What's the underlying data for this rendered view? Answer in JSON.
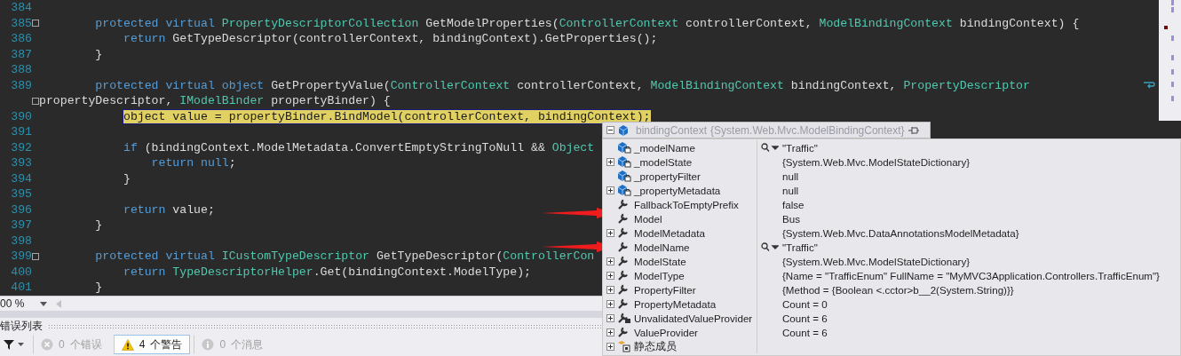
{
  "editor": {
    "lines": [
      {
        "kind": "line",
        "number": "384",
        "fold": false,
        "highlighted": false
      },
      {
        "kind": "line",
        "number": "385",
        "fold": true,
        "highlighted": false,
        "segments": [
          {
            "text": "        protected virtual",
            "kind": "keyword"
          },
          {
            "text": " PropertyDescriptorCollection",
            "kind": "type"
          },
          {
            "text": " GetModelProperties(",
            "kind": "plain"
          },
          {
            "text": "ControllerContext",
            "kind": "type"
          },
          {
            "text": " controllerContext, ",
            "kind": "plain"
          },
          {
            "text": "ModelBindingContext",
            "kind": "type"
          },
          {
            "text": " bindingContext) {",
            "kind": "plain"
          }
        ]
      },
      {
        "kind": "line",
        "number": "386",
        "fold": false,
        "highlighted": false,
        "segments": [
          {
            "text": "            return",
            "kind": "keyword"
          },
          {
            "text": " GetTypeDescriptor(controllerContext, bindingContext).GetProperties();",
            "kind": "plain"
          }
        ]
      },
      {
        "kind": "line",
        "number": "387",
        "fold": false,
        "highlighted": false,
        "segments": [
          {
            "text": "        }",
            "kind": "plain"
          }
        ]
      },
      {
        "kind": "line",
        "number": "388",
        "fold": false,
        "highlighted": false
      },
      {
        "kind": "line",
        "number": "389",
        "fold": false,
        "highlighted": false,
        "wrapped": true,
        "segments": [
          {
            "text": "        protected virtual object",
            "kind": "keyword"
          },
          {
            "text": " GetPropertyValue(",
            "kind": "plain"
          },
          {
            "text": "ControllerContext",
            "kind": "type"
          },
          {
            "text": " controllerContext, ",
            "kind": "plain"
          },
          {
            "text": "ModelBindingContext",
            "kind": "type"
          },
          {
            "text": " bindingContext, ",
            "kind": "plain"
          },
          {
            "text": "PropertyDescriptor",
            "kind": "type"
          }
        ]
      },
      {
        "kind": "wrap",
        "fold": true,
        "highlighted": false,
        "segments": [
          {
            "text": "propertyDescriptor, ",
            "kind": "plain"
          },
          {
            "text": "IModelBinder",
            "kind": "type"
          },
          {
            "text": " propertyBinder) {",
            "kind": "plain"
          }
        ]
      },
      {
        "kind": "line",
        "number": "390",
        "fold": false,
        "highlighted": true,
        "segments": [
          {
            "text": "            object",
            "kind": "keyword"
          },
          {
            "text": " value = propertyBinder.BindModel(controllerContext, bindingContext);",
            "kind": "plain"
          }
        ]
      },
      {
        "kind": "line",
        "number": "391",
        "fold": false,
        "highlighted": false
      },
      {
        "kind": "line",
        "number": "392",
        "fold": false,
        "highlighted": false,
        "segments": [
          {
            "text": "            if",
            "kind": "keyword"
          },
          {
            "text": " (bindingContext.ModelMetadata.ConvertEmptyStringToNull && ",
            "kind": "plain"
          },
          {
            "text": "Object",
            "kind": "type"
          }
        ]
      },
      {
        "kind": "line",
        "number": "393",
        "fold": false,
        "highlighted": false,
        "segments": [
          {
            "text": "                return null",
            "kind": "keyword"
          },
          {
            "text": ";",
            "kind": "plain"
          }
        ]
      },
      {
        "kind": "line",
        "number": "394",
        "fold": false,
        "highlighted": false,
        "segments": [
          {
            "text": "            }",
            "kind": "plain"
          }
        ]
      },
      {
        "kind": "line",
        "number": "395",
        "fold": false,
        "highlighted": false
      },
      {
        "kind": "line",
        "number": "396",
        "fold": false,
        "highlighted": false,
        "segments": [
          {
            "text": "            return",
            "kind": "keyword"
          },
          {
            "text": " value;",
            "kind": "plain"
          }
        ]
      },
      {
        "kind": "line",
        "number": "397",
        "fold": false,
        "highlighted": false,
        "segments": [
          {
            "text": "        }",
            "kind": "plain"
          }
        ]
      },
      {
        "kind": "line",
        "number": "398",
        "fold": false,
        "highlighted": false
      },
      {
        "kind": "line",
        "number": "399",
        "fold": true,
        "highlighted": false,
        "segments": [
          {
            "text": "        protected virtual",
            "kind": "keyword"
          },
          {
            "text": " ICustomTypeDescriptor",
            "kind": "type"
          },
          {
            "text": " GetTypeDescriptor(",
            "kind": "plain"
          },
          {
            "text": "ControllerCon",
            "kind": "type"
          }
        ]
      },
      {
        "kind": "line",
        "number": "400",
        "fold": false,
        "highlighted": false,
        "segments": [
          {
            "text": "            return",
            "kind": "keyword"
          },
          {
            "text": " TypeDescriptorHelper",
            "kind": "type"
          },
          {
            "text": ".Get(bindingContext.ModelType);",
            "kind": "plain"
          }
        ]
      },
      {
        "kind": "line",
        "number": "401",
        "fold": false,
        "highlighted": false,
        "segments": [
          {
            "text": "        }",
            "kind": "plain"
          }
        ]
      }
    ],
    "zoom": "00 %"
  },
  "datatip": {
    "expanded": true,
    "name": "bindingContext",
    "type": "{System.Web.Mvc.ModelBindingContext}",
    "rows": [
      {
        "name": "_modelName",
        "value": "\"Traffic\"",
        "kind": "field",
        "expandable": false,
        "visualizer": true
      },
      {
        "name": "_modelState",
        "value": "{System.Web.Mvc.ModelStateDictionary}",
        "kind": "field",
        "expandable": true,
        "visualizer": false
      },
      {
        "name": "_propertyFilter",
        "value": "null",
        "kind": "field",
        "expandable": false,
        "visualizer": false
      },
      {
        "name": "_propertyMetadata",
        "value": "null",
        "kind": "field",
        "expandable": true,
        "visualizer": false
      },
      {
        "name": "FallbackToEmptyPrefix",
        "value": "false",
        "kind": "property",
        "expandable": false,
        "visualizer": false
      },
      {
        "name": "Model",
        "value": "Bus",
        "kind": "property",
        "expandable": false,
        "visualizer": false
      },
      {
        "name": "ModelMetadata",
        "value": "{System.Web.Mvc.DataAnnotationsModelMetadata}",
        "kind": "property",
        "expandable": true,
        "visualizer": false
      },
      {
        "name": "ModelName",
        "value": "\"Traffic\"",
        "kind": "property",
        "expandable": false,
        "visualizer": true
      },
      {
        "name": "ModelState",
        "value": "{System.Web.Mvc.ModelStateDictionary}",
        "kind": "property",
        "expandable": true,
        "visualizer": false
      },
      {
        "name": "ModelType",
        "value": "{Name = \"TrafficEnum\" FullName = \"MyMVC3Application.Controllers.TrafficEnum\"}",
        "kind": "property",
        "expandable": true,
        "visualizer": false
      },
      {
        "name": "PropertyFilter",
        "value": "{Method = {Boolean <.cctor>b__2(System.String)}}",
        "kind": "property",
        "expandable": true,
        "visualizer": false
      },
      {
        "name": "PropertyMetadata",
        "value": "Count = 0",
        "kind": "property",
        "expandable": true,
        "visualizer": false
      },
      {
        "name": "UnvalidatedValueProvider",
        "value": "Count = 6",
        "kind": "provider",
        "expandable": true,
        "visualizer": false
      },
      {
        "name": "ValueProvider",
        "value": "Count = 6",
        "kind": "property",
        "expandable": true,
        "visualizer": false
      },
      {
        "name": "静态成员",
        "kind": "static",
        "expandable": true,
        "visualizer": false
      }
    ]
  },
  "annotations": [
    {
      "kind": "arrow"
    },
    {
      "kind": "arrow"
    }
  ],
  "error_list": {
    "title": "错误列表",
    "filters": [
      {
        "kind": "error",
        "count": "0",
        "label": "个错误",
        "selected": false
      },
      {
        "kind": "warning",
        "count": "4",
        "label": "个警告",
        "selected": true
      },
      {
        "kind": "message",
        "count": "0",
        "label": "个消息",
        "selected": false
      }
    ]
  }
}
